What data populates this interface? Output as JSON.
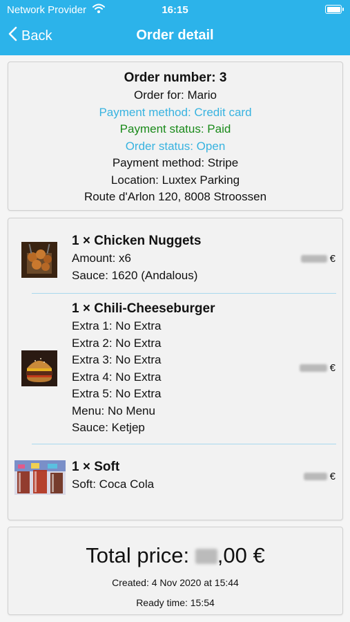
{
  "status_bar": {
    "carrier": "Network Provider",
    "time": "16:15"
  },
  "nav": {
    "back_label": "Back",
    "title": "Order detail"
  },
  "order": {
    "number_line": "Order number: 3",
    "order_for": "Order for: Mario",
    "payment_method": "Payment method: Credit card",
    "payment_status": "Payment status: Paid",
    "order_status": "Order status: Open",
    "payment_provider": "Payment method: Stripe",
    "location": "Location: Luxtex Parking",
    "address": "Route d'Arlon 120, 8008 Stroossen"
  },
  "items": [
    {
      "name": "1 × Chicken Nuggets",
      "details": [
        "Amount: x6",
        "Sauce: 1620 (Andalous)"
      ],
      "currency": "€"
    },
    {
      "name": "1 × Chili-Cheeseburger",
      "details": [
        "Extra 1: No Extra",
        "Extra 2: No Extra",
        "Extra 3: No Extra",
        "Extra 4: No Extra",
        "Extra 5: No Extra",
        "Menu: No Menu",
        "Sauce: Ketjep"
      ],
      "currency": "€"
    },
    {
      "name": "1 × Soft",
      "details": [
        "Soft: Coca Cola"
      ],
      "currency": "€"
    }
  ],
  "summary": {
    "total_prefix": "Total price:",
    "total_suffix": ",00 €",
    "created": "Created: 4 Nov 2020 at 15:44",
    "ready": "Ready time: 15:54"
  },
  "colors": {
    "accent": "#2cb3ea",
    "info_blue": "#38b3e0",
    "paid_green": "#1a8a1a"
  }
}
